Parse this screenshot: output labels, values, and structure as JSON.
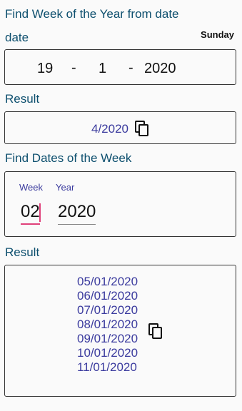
{
  "week_of_year": {
    "title": "Find Week of the Year from date",
    "date_label": "date",
    "first_day": "Sunday",
    "day": "19",
    "month": "1",
    "year": "2020",
    "separator": "-",
    "result_label": "Result",
    "result_value": "4/2020"
  },
  "dates_of_week": {
    "title": "Find Dates of the Week",
    "week_label": "Week",
    "year_label": "Year",
    "week_value": "02",
    "year_value": "2020",
    "result_label": "Result",
    "dates": [
      "05/01/2020",
      "06/01/2020",
      "07/01/2020",
      "08/01/2020",
      "09/01/2020",
      "10/01/2020",
      "11/01/2020"
    ]
  },
  "colors": {
    "title": "#0d4f6e",
    "result_text": "#3b3b9e",
    "active_underline": "#e0407a"
  }
}
